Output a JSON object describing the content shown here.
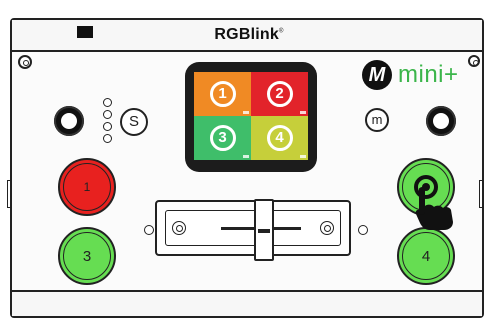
{
  "device": {
    "brand": "RGBlink",
    "brand_mark": "®",
    "model_logo_letter": "M",
    "model_name": "mini+"
  },
  "controls": {
    "s_button_label": "S",
    "m_button_label": "m"
  },
  "screen": {
    "quadrants": [
      {
        "label": "1",
        "color": "#f08a24"
      },
      {
        "label": "2",
        "color": "#e2232a"
      },
      {
        "label": "3",
        "color": "#3fbe6a"
      },
      {
        "label": "4",
        "color": "#c6cf3a"
      }
    ]
  },
  "buttons": {
    "input1": {
      "label": "1",
      "color": "#e8211f"
    },
    "input3": {
      "label": "3",
      "color": "#66dd52"
    },
    "input2": {
      "label": "",
      "color": "#66dd52"
    },
    "input4": {
      "label": "4",
      "color": "#66dd52"
    }
  },
  "colors": {
    "logo_green": "#3bb54a",
    "outline": "#222222"
  }
}
